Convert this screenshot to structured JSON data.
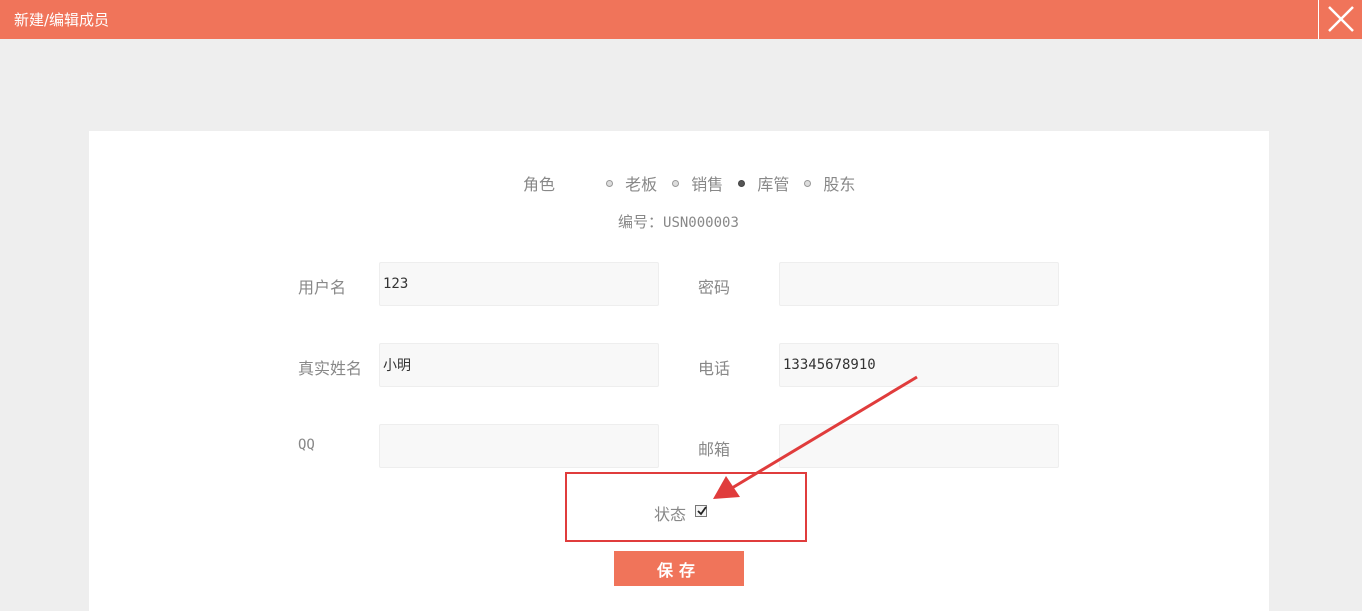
{
  "window": {
    "title": "新建/编辑成员"
  },
  "role": {
    "label": "角色",
    "options": [
      {
        "label": "老板",
        "selected": false
      },
      {
        "label": "销售",
        "selected": false
      },
      {
        "label": "库管",
        "selected": true
      },
      {
        "label": "股东",
        "selected": false
      }
    ]
  },
  "code": {
    "label": "编号：",
    "value": "USN000003"
  },
  "fields": {
    "username": {
      "label": "用户名",
      "value": "123"
    },
    "password": {
      "label": "密码",
      "value": ""
    },
    "realname": {
      "label": "真实姓名",
      "value": "小明"
    },
    "phone": {
      "label": "电话",
      "value": "13345678910"
    },
    "qq": {
      "label": "QQ",
      "value": ""
    },
    "email": {
      "label": "邮箱",
      "value": ""
    }
  },
  "status": {
    "label": "状态",
    "checked": true
  },
  "save": {
    "label": "保存"
  },
  "colors": {
    "accent": "#f0745a",
    "highlight": "#e03c3c"
  }
}
